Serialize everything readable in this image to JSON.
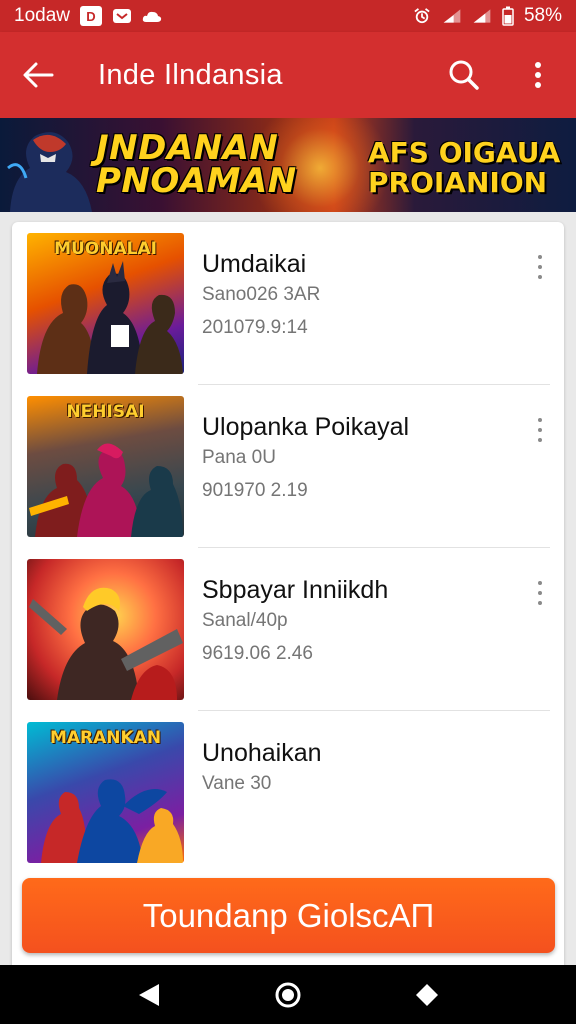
{
  "status_bar": {
    "time": "1odaw",
    "box_icon": "D",
    "battery": "58%"
  },
  "app_bar": {
    "title": "Inde Ilndansia",
    "back_icon": "arrow-back-icon",
    "search_icon": "search-icon",
    "more_icon": "more-vert-icon"
  },
  "banner": {
    "left_line1": "JNDANAN",
    "left_line2": "PNOAMAN",
    "right_line1": "AFS OIGAUA",
    "right_line2": "PROIANION"
  },
  "list": {
    "items": [
      {
        "logo": "MUONALAI",
        "name": "Umdaikai",
        "line1": "Sano026 3AR",
        "line2": "201079.9:14",
        "has_more": true
      },
      {
        "logo": "NEHISAI",
        "name": "Ulopanka Poikayal",
        "line1": "Pana 0U",
        "line2": "901970 2.19",
        "has_more": true
      },
      {
        "logo": "",
        "name": "Sbpayar Inniikdh",
        "line1": "Sanal/40p",
        "line2": "9619.06 2.46",
        "has_more": true
      },
      {
        "logo": "MARANKAN",
        "name": "Unohaikan",
        "line1": "Vane 30",
        "line2": "",
        "has_more": false
      }
    ]
  },
  "cta": {
    "label": "Toundanp GiolscAП"
  },
  "colors": {
    "primary": "#d32f2f",
    "status": "#c62828",
    "accent": "#f4511e"
  }
}
